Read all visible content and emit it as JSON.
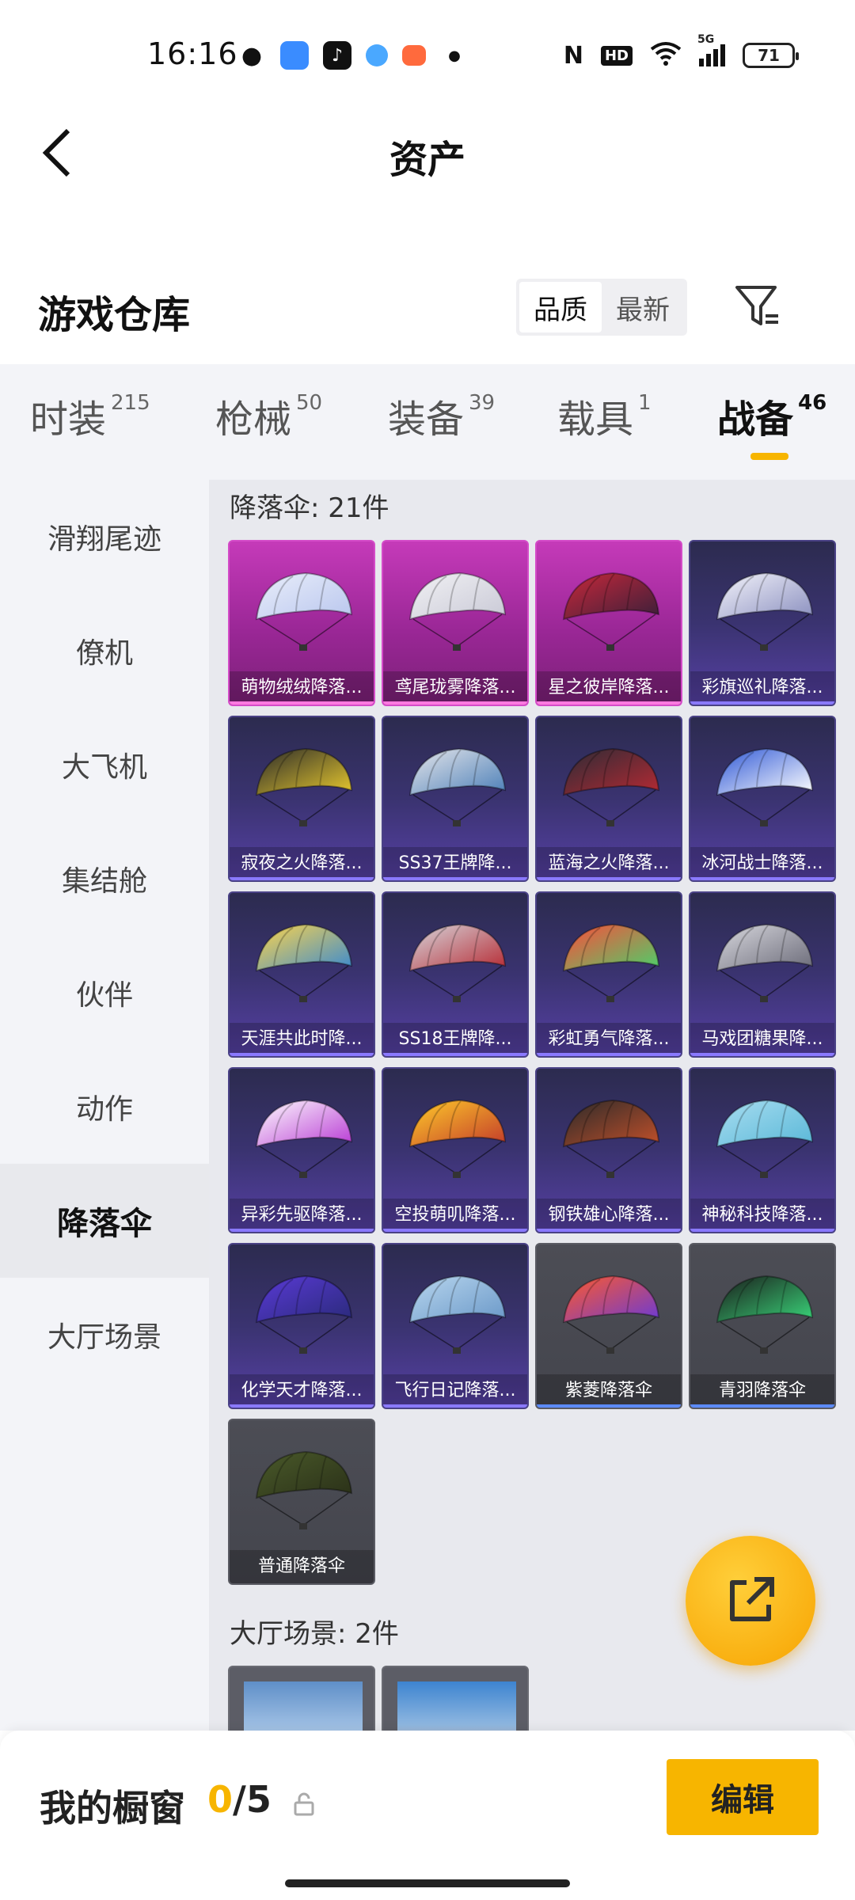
{
  "status_bar": {
    "time": "16:16",
    "battery": "71",
    "network": "5G",
    "hd": "HD"
  },
  "header": {
    "title": "资产"
  },
  "warehouse": {
    "title": "游戏仓库",
    "sort_options": [
      "品质",
      "最新"
    ],
    "active_sort": "品质"
  },
  "category_tabs": [
    {
      "label": "时装",
      "count": "215"
    },
    {
      "label": "枪械",
      "count": "50"
    },
    {
      "label": "装备",
      "count": "39"
    },
    {
      "label": "载具",
      "count": "1"
    },
    {
      "label": "战备",
      "count": "46"
    }
  ],
  "active_tab": "战备",
  "sidebar": {
    "items": [
      "滑翔尾迹",
      "僚机",
      "大飞机",
      "集结舱",
      "伙伴",
      "动作",
      "降落伞",
      "大厅场景"
    ],
    "active": "降落伞"
  },
  "sections": {
    "parachute_title": "降落伞: 21件",
    "scene_title": "大厅场景: 2件"
  },
  "parachutes": [
    {
      "name": "萌物绒绒降落...",
      "rarity": "pink"
    },
    {
      "name": "鸢尾珑雾降落...",
      "rarity": "pink"
    },
    {
      "name": "星之彼岸降落...",
      "rarity": "pink"
    },
    {
      "name": "彩旗巡礼降落...",
      "rarity": "purple"
    },
    {
      "name": "寂夜之火降落...",
      "rarity": "purple"
    },
    {
      "name": "SS37王牌降...",
      "rarity": "purple"
    },
    {
      "name": "蓝海之火降落...",
      "rarity": "purple"
    },
    {
      "name": "冰河战士降落...",
      "rarity": "purple"
    },
    {
      "name": "天涯共此时降...",
      "rarity": "purple"
    },
    {
      "name": "SS18王牌降...",
      "rarity": "purple"
    },
    {
      "name": "彩虹勇气降落...",
      "rarity": "purple"
    },
    {
      "name": "马戏团糖果降...",
      "rarity": "purple"
    },
    {
      "name": "异彩先驱降落...",
      "rarity": "purple"
    },
    {
      "name": "空投萌叽降落...",
      "rarity": "purple"
    },
    {
      "name": "钢铁雄心降落...",
      "rarity": "purple"
    },
    {
      "name": "神秘科技降落...",
      "rarity": "purple"
    },
    {
      "name": "化学天才降落...",
      "rarity": "purple"
    },
    {
      "name": "飞行日记降落...",
      "rarity": "purple"
    },
    {
      "name": "紫菱降落伞",
      "rarity": "gray-blue"
    },
    {
      "name": "青羽降落伞",
      "rarity": "gray-blue"
    },
    {
      "name": "普通降落伞",
      "rarity": "gray"
    }
  ],
  "bottom_bar": {
    "showcase_label": "我的橱窗",
    "showcase_current": "0",
    "showcase_total": "/5",
    "edit_label": "编辑"
  },
  "colors": {
    "accent": "#f7b500",
    "pink_card": "#b8309f",
    "purple_card": "#3a3370",
    "gray_card": "#4c4d55"
  }
}
